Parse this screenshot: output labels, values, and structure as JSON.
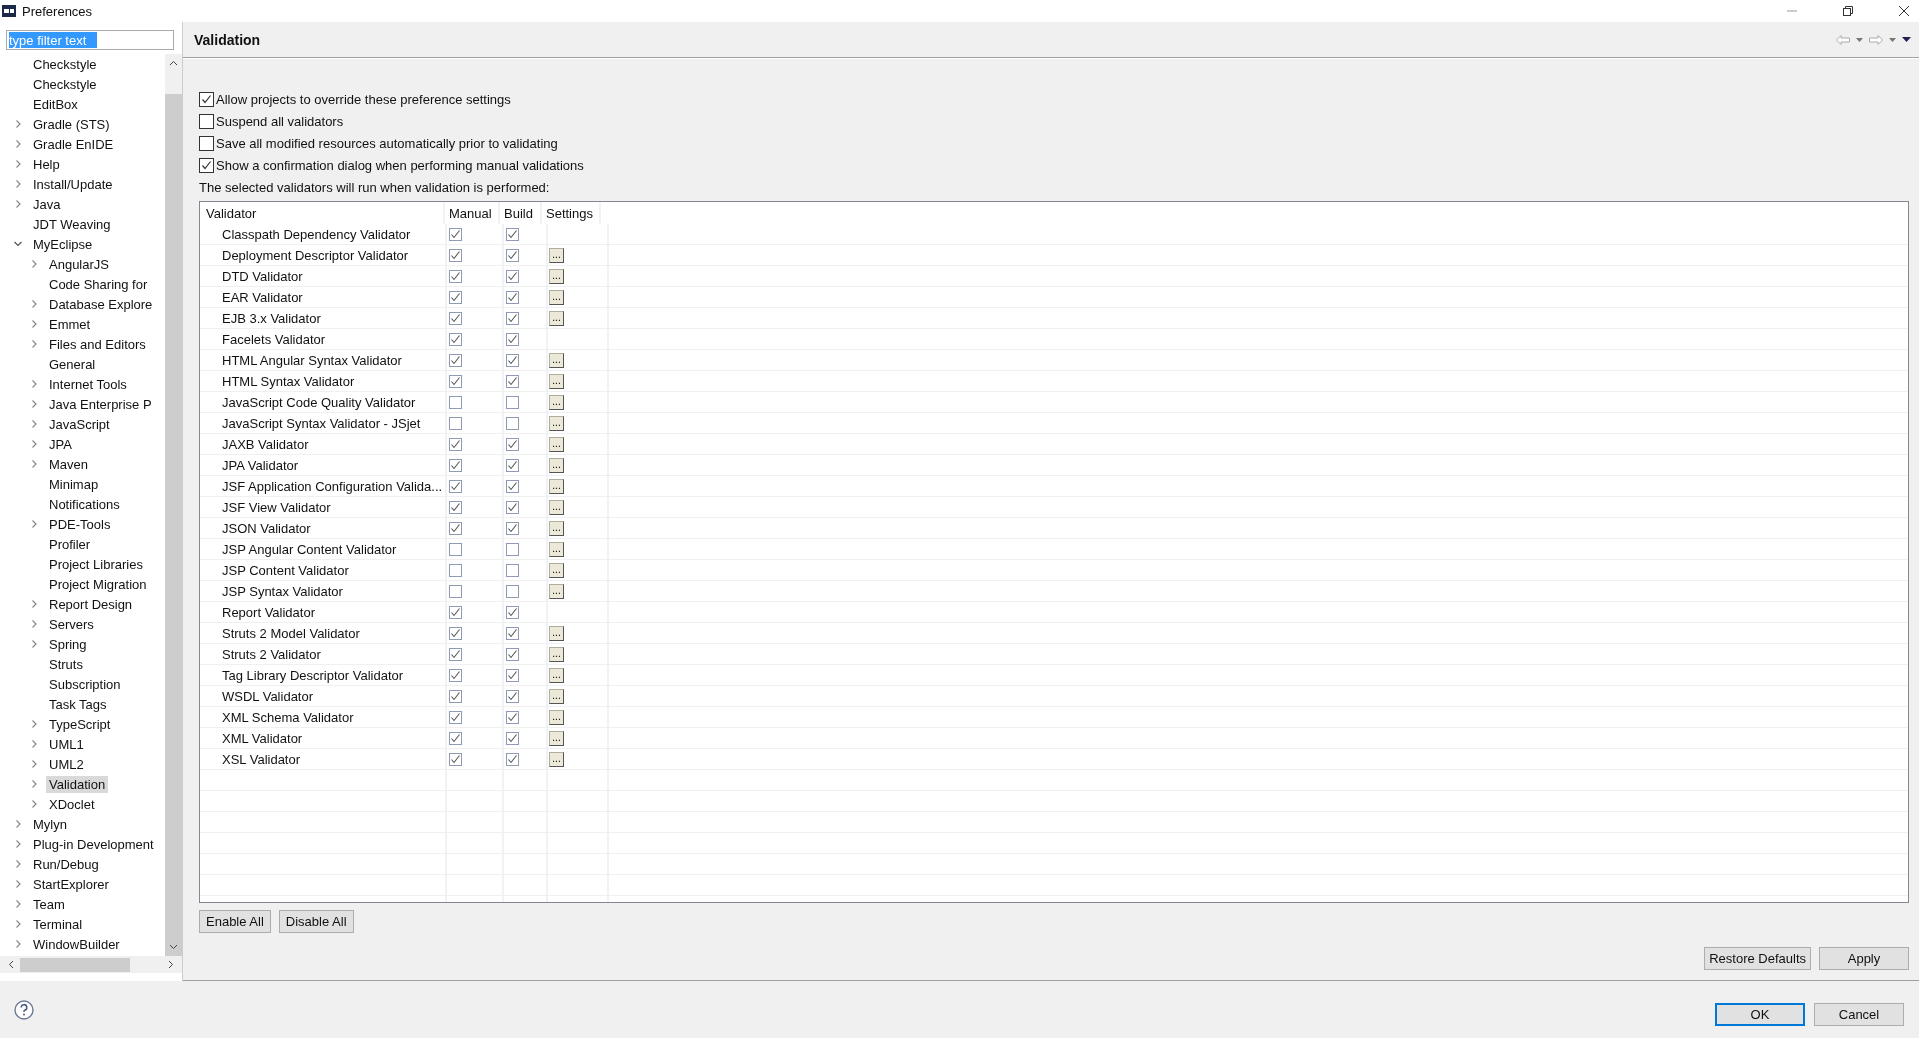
{
  "window": {
    "title": "Preferences"
  },
  "filter": {
    "value": "type filter text"
  },
  "tree": [
    {
      "label": "Checkstyle",
      "selected": false
    },
    {
      "label": "Checkstyle",
      "selected": false
    },
    {
      "label": "EditBox",
      "selected": false
    },
    {
      "label": "Gradle (STS)",
      "selected": false,
      "expanded": false
    },
    {
      "label": "Gradle EnIDE",
      "selected": false,
      "expanded": false
    },
    {
      "label": "Help",
      "selected": false,
      "expanded": false
    },
    {
      "label": "Install/Update",
      "selected": false,
      "expanded": false
    },
    {
      "label": "Java",
      "selected": false,
      "expanded": false
    },
    {
      "label": "JDT Weaving",
      "selected": false
    },
    {
      "label": "MyEclipse",
      "selected": false,
      "expanded": true,
      "children": [
        {
          "label": "AngularJS",
          "selected": false,
          "expanded": false
        },
        {
          "label": "Code Sharing for",
          "selected": false
        },
        {
          "label": "Database Explore",
          "selected": false,
          "expanded": false
        },
        {
          "label": "Emmet",
          "selected": false,
          "expanded": false
        },
        {
          "label": "Files and Editors",
          "selected": false,
          "expanded": false
        },
        {
          "label": "General",
          "selected": false
        },
        {
          "label": "Internet Tools",
          "selected": false,
          "expanded": false
        },
        {
          "label": "Java Enterprise P",
          "selected": false,
          "expanded": false
        },
        {
          "label": "JavaScript",
          "selected": false,
          "expanded": false
        },
        {
          "label": "JPA",
          "selected": false,
          "expanded": false
        },
        {
          "label": "Maven",
          "selected": false,
          "expanded": false
        },
        {
          "label": "Minimap",
          "selected": false
        },
        {
          "label": "Notifications",
          "selected": false
        },
        {
          "label": "PDE-Tools",
          "selected": false,
          "expanded": false
        },
        {
          "label": "Profiler",
          "selected": false
        },
        {
          "label": "Project Libraries",
          "selected": false
        },
        {
          "label": "Project Migration",
          "selected": false
        },
        {
          "label": "Report Design",
          "selected": false,
          "expanded": false
        },
        {
          "label": "Servers",
          "selected": false,
          "expanded": false
        },
        {
          "label": "Spring",
          "selected": false,
          "expanded": false
        },
        {
          "label": "Struts",
          "selected": false
        },
        {
          "label": "Subscription",
          "selected": false
        },
        {
          "label": "Task Tags",
          "selected": false
        },
        {
          "label": "TypeScript",
          "selected": false,
          "expanded": false
        },
        {
          "label": "UML1",
          "selected": false,
          "expanded": false
        },
        {
          "label": "UML2",
          "selected": false,
          "expanded": false
        },
        {
          "label": "Validation",
          "selected": true,
          "expanded": false
        },
        {
          "label": "XDoclet",
          "selected": false,
          "expanded": false
        }
      ]
    },
    {
      "label": "Mylyn",
      "selected": false,
      "expanded": false
    },
    {
      "label": "Plug-in Development",
      "selected": false,
      "expanded": false
    },
    {
      "label": "Run/Debug",
      "selected": false,
      "expanded": false
    },
    {
      "label": "StartExplorer",
      "selected": false,
      "expanded": false
    },
    {
      "label": "Team",
      "selected": false,
      "expanded": false
    },
    {
      "label": "Terminal",
      "selected": false,
      "expanded": false
    },
    {
      "label": "WindowBuilder",
      "selected": false,
      "expanded": false
    }
  ],
  "page": {
    "title": "Validation"
  },
  "options": [
    {
      "label": "Allow projects to override these preference settings",
      "checked": true
    },
    {
      "label": "Suspend all validators",
      "checked": false
    },
    {
      "label": "Save all modified resources automatically prior to validating",
      "checked": false
    },
    {
      "label": "Show a confirmation dialog when performing manual validations",
      "checked": true
    }
  ],
  "intro": "The selected validators will run when validation is performed:",
  "table": {
    "columns": [
      "Validator",
      "Manual",
      "Build",
      "Settings"
    ],
    "rows": [
      {
        "name": "Classpath Dependency Validator",
        "manual": true,
        "build": true
      },
      {
        "name": "Deployment Descriptor Validator",
        "manual": true,
        "build": true,
        "settings": "..."
      },
      {
        "name": "DTD Validator",
        "manual": true,
        "build": true,
        "settings": "..."
      },
      {
        "name": "EAR Validator",
        "manual": true,
        "build": true,
        "settings": "..."
      },
      {
        "name": "EJB 3.x Validator",
        "manual": true,
        "build": true,
        "settings": "..."
      },
      {
        "name": "Facelets Validator",
        "manual": true,
        "build": true
      },
      {
        "name": "HTML Angular Syntax Validator",
        "manual": true,
        "build": true,
        "settings": "..."
      },
      {
        "name": "HTML Syntax Validator",
        "manual": true,
        "build": true,
        "settings": "..."
      },
      {
        "name": "JavaScript Code Quality Validator",
        "manual": false,
        "build": false,
        "settings": "..."
      },
      {
        "name": "JavaScript Syntax Validator - JSjet",
        "manual": false,
        "build": false,
        "settings": "..."
      },
      {
        "name": "JAXB Validator",
        "manual": true,
        "build": true,
        "settings": "..."
      },
      {
        "name": "JPA Validator",
        "manual": true,
        "build": true,
        "settings": "..."
      },
      {
        "name": "JSF Application Configuration Valida...",
        "manual": true,
        "build": true,
        "settings": "..."
      },
      {
        "name": "JSF View Validator",
        "manual": true,
        "build": true,
        "settings": "..."
      },
      {
        "name": "JSON Validator",
        "manual": true,
        "build": true,
        "settings": "..."
      },
      {
        "name": "JSP Angular Content Validator",
        "manual": false,
        "build": false,
        "settings": "..."
      },
      {
        "name": "JSP Content Validator",
        "manual": false,
        "build": false,
        "settings": "..."
      },
      {
        "name": "JSP Syntax Validator",
        "manual": false,
        "build": false,
        "settings": "..."
      },
      {
        "name": "Report Validator",
        "manual": true,
        "build": true
      },
      {
        "name": "Struts 2 Model Validator",
        "manual": true,
        "build": true,
        "settings": "..."
      },
      {
        "name": "Struts 2 Validator",
        "manual": true,
        "build": true,
        "settings": "..."
      },
      {
        "name": "Tag Library Descriptor Validator",
        "manual": true,
        "build": true,
        "settings": "..."
      },
      {
        "name": "WSDL Validator",
        "manual": true,
        "build": true,
        "settings": "..."
      },
      {
        "name": "XML Schema Validator",
        "manual": true,
        "build": true,
        "settings": "..."
      },
      {
        "name": "XML Validator",
        "manual": true,
        "build": true,
        "settings": "..."
      },
      {
        "name": "XSL Validator",
        "manual": true,
        "build": true,
        "settings": "..."
      }
    ]
  },
  "table_buttons": [
    "Enable All",
    "Disable All"
  ],
  "page_buttons": [
    "Restore Defaults",
    "Apply"
  ],
  "dialog_buttons": [
    {
      "label": "OK",
      "selected": true
    },
    {
      "label": "Cancel",
      "selected": false
    }
  ]
}
